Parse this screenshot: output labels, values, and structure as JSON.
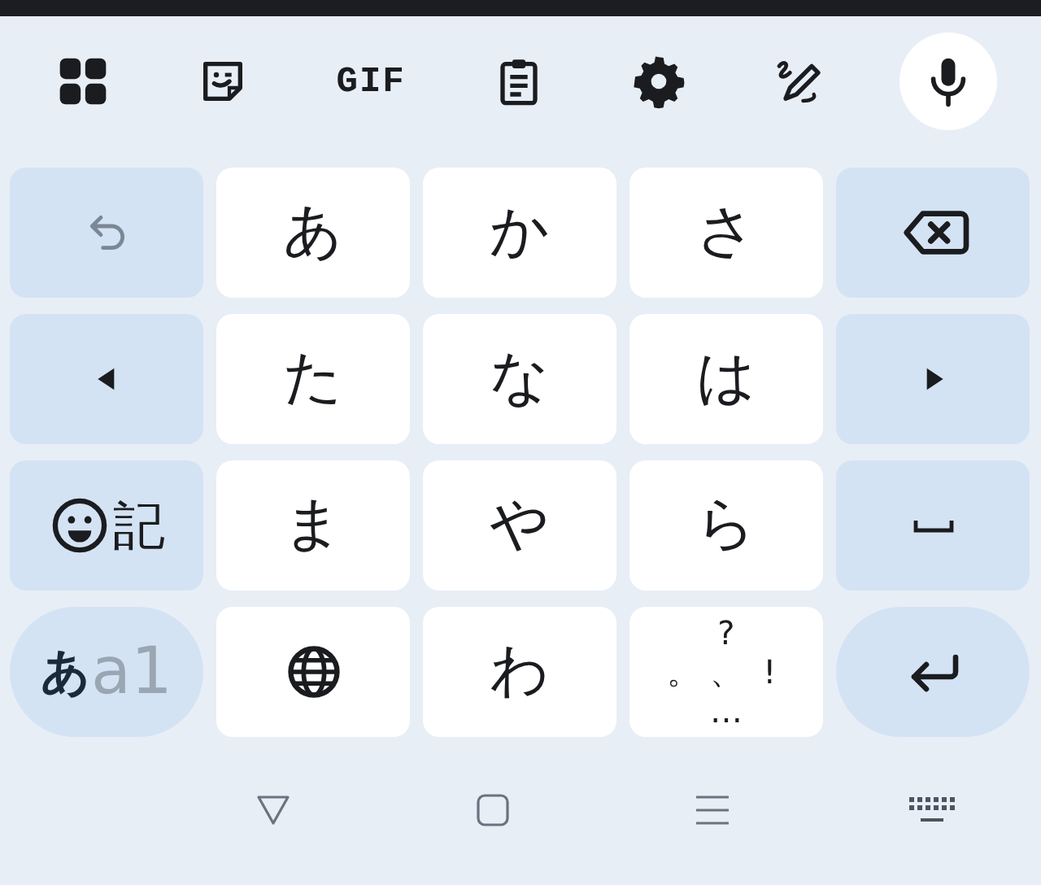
{
  "toolbar": [
    {
      "kind": "apps"
    },
    {
      "kind": "sticker"
    },
    {
      "kind": "gif",
      "label": "GIF"
    },
    {
      "kind": "clipboard"
    },
    {
      "kind": "settings"
    },
    {
      "kind": "handwriting"
    },
    {
      "kind": "mic"
    }
  ],
  "keys": [
    [
      {
        "kind": "undo",
        "disabled": true
      },
      {
        "kind": "char",
        "label": "あ",
        "disabled": false
      },
      {
        "kind": "char",
        "label": "か",
        "disabled": false
      },
      {
        "kind": "char",
        "label": "さ",
        "disabled": false
      },
      {
        "kind": "delete",
        "disabled": false
      }
    ],
    [
      {
        "kind": "left",
        "disabled": false
      },
      {
        "kind": "char",
        "label": "た",
        "disabled": false
      },
      {
        "kind": "char",
        "label": "な",
        "disabled": false
      },
      {
        "kind": "char",
        "label": "は",
        "disabled": false
      },
      {
        "kind": "right",
        "disabled": false
      }
    ],
    [
      {
        "kind": "emoji",
        "label": "記",
        "disabled": false
      },
      {
        "kind": "char",
        "label": "ま",
        "disabled": false
      },
      {
        "kind": "char",
        "label": "や",
        "disabled": false
      },
      {
        "kind": "char",
        "label": "ら",
        "disabled": false
      },
      {
        "kind": "space",
        "disabled": false
      }
    ],
    [
      {
        "kind": "mode",
        "label": "あ",
        "alt_label": "a1",
        "disabled": false
      },
      {
        "kind": "globe",
        "disabled": false
      },
      {
        "kind": "char",
        "label": "わ",
        "disabled": false
      },
      {
        "kind": "punct",
        "top": "?",
        "left": "。",
        "middle": "、",
        "right": "!",
        "bottom": "…",
        "disabled": false
      },
      {
        "kind": "enter",
        "disabled": false
      }
    ]
  ],
  "nav": [
    {
      "kind": "back"
    },
    {
      "kind": "home"
    },
    {
      "kind": "recents"
    },
    {
      "kind": "keyboard"
    }
  ]
}
